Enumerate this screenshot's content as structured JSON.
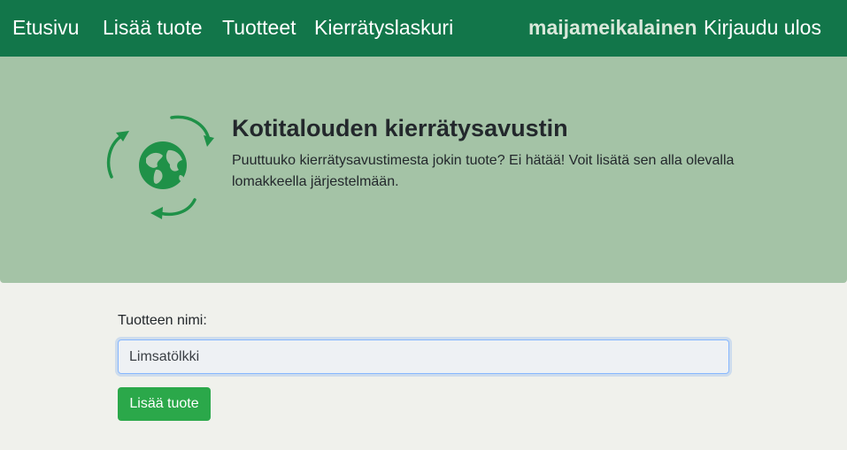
{
  "navbar": {
    "links": [
      "Etusivu",
      "Lisää tuote",
      "Tuotteet",
      "Kierrätyslaskuri"
    ],
    "username": "maijameikalainen",
    "logout_label": "Kirjaudu ulos",
    "background_color": "#12764a"
  },
  "hero": {
    "title": "Kotitalouden kierrätysavustin",
    "description": "Puuttuuko kierrätysavustimesta jokin tuote? Ei hätää! Voit lisätä sen alla olevalla lomakkeella järjestelmään.",
    "icon": "recycle-globe-icon",
    "background_color": "#a4c3a6"
  },
  "form": {
    "label": "Tuotteen nimi:",
    "input_value": "Limsatölkki",
    "submit_label": "Lisää tuote",
    "button_color": "#2ba84a"
  }
}
